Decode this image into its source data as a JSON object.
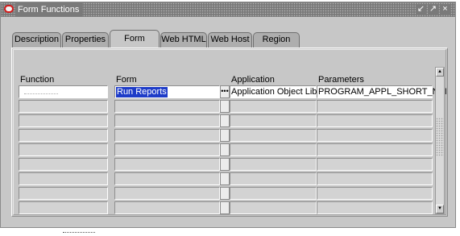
{
  "window": {
    "title": "Form Functions",
    "controls": {
      "minimize": "↙",
      "maximize": "↗",
      "close": "×"
    }
  },
  "tabs": [
    {
      "label": "Description"
    },
    {
      "label": "Properties"
    },
    {
      "label": "Form",
      "active": true
    },
    {
      "label": "Web HTML"
    },
    {
      "label": "Web Host"
    },
    {
      "label": "Region"
    }
  ],
  "table": {
    "columns": [
      "Function",
      "Form",
      "Application",
      "Parameters"
    ],
    "rows": [
      {
        "function": "",
        "form": "Run Reports",
        "application": "Application Object Libra",
        "parameters": "PROGRAM_APPL_SHORT_NAI"
      },
      {
        "function": "",
        "form": "",
        "application": "",
        "parameters": ""
      },
      {
        "function": "",
        "form": "",
        "application": "",
        "parameters": ""
      },
      {
        "function": "",
        "form": "",
        "application": "",
        "parameters": ""
      },
      {
        "function": "",
        "form": "",
        "application": "",
        "parameters": ""
      },
      {
        "function": "",
        "form": "",
        "application": "",
        "parameters": ""
      },
      {
        "function": "",
        "form": "",
        "application": "",
        "parameters": ""
      },
      {
        "function": "",
        "form": "",
        "application": "",
        "parameters": ""
      },
      {
        "function": "",
        "form": "",
        "application": "",
        "parameters": ""
      }
    ],
    "lov_glyph": "•••"
  },
  "scrollbar": {
    "up": "▲",
    "down": "▼"
  },
  "colors": {
    "selection": "#1e3cc8",
    "window_bg": "#c7c7c7",
    "title_icon": "#d21a1a"
  }
}
